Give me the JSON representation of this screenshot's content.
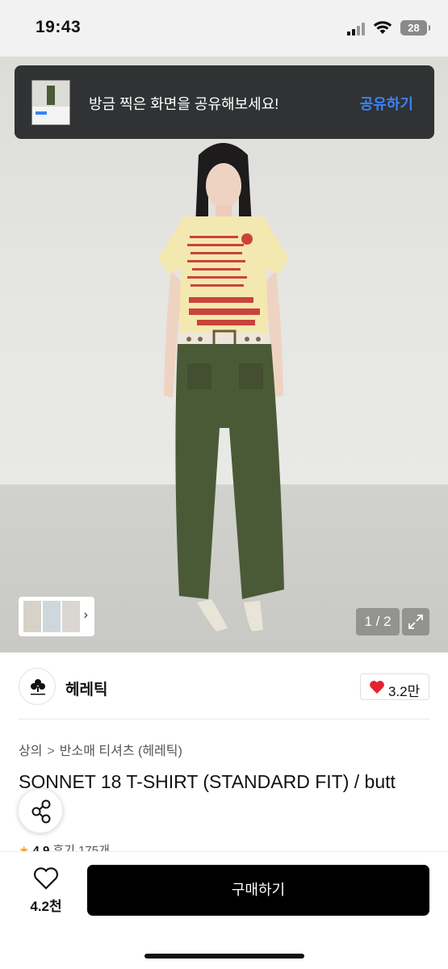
{
  "status_bar": {
    "time": "19:43",
    "battery": "28"
  },
  "toast": {
    "message": "방금 찍은 화면을 공유해보세요!",
    "action": "공유하기"
  },
  "gallery": {
    "counter": "1 / 2"
  },
  "brand": {
    "name": "헤레틱",
    "likes": "3.2만"
  },
  "breadcrumb": {
    "category": "상의",
    "separator": ">",
    "subcategory": "반소매 티셔츠 (헤레틱)"
  },
  "product": {
    "title": "SONNET 18 T-SHIRT (STANDARD FIT) / butt"
  },
  "rating": {
    "score": "4.9",
    "reviews": "후기 175개"
  },
  "bottom_bar": {
    "wishlist_count": "4.2천",
    "buy_label": "구매하기"
  },
  "colors": {
    "accent_blue": "#3b82f6",
    "heart_red": "#e5232e",
    "buy_bg": "#000000"
  }
}
